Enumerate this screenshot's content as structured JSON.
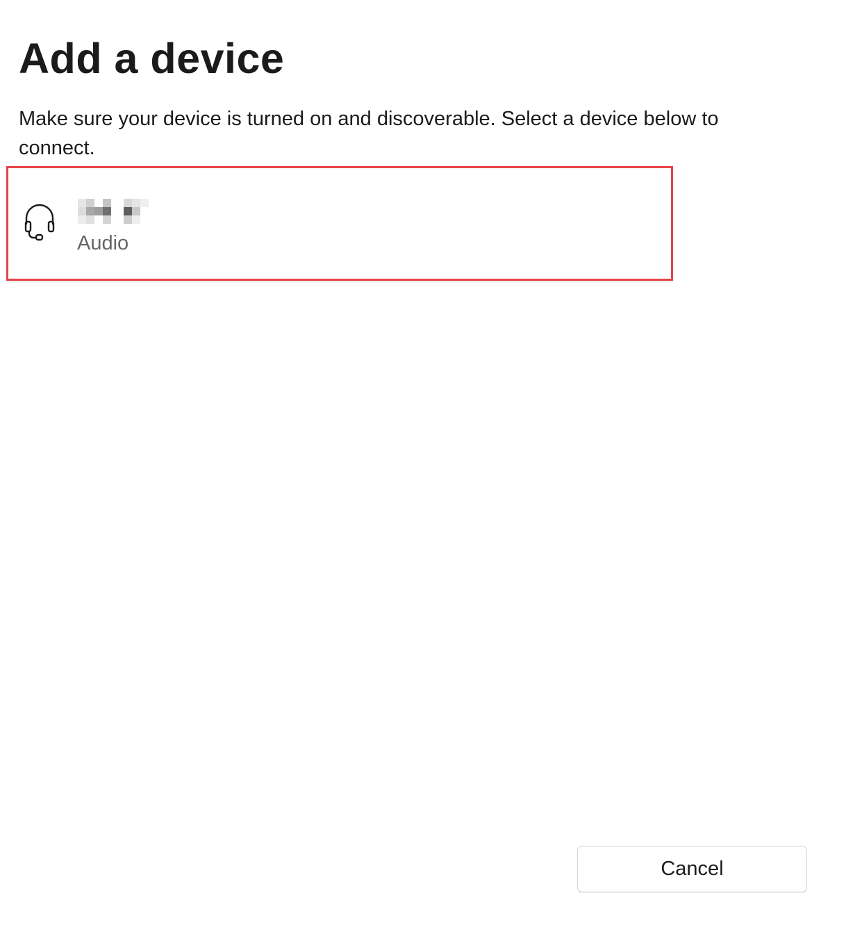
{
  "dialog": {
    "title": "Add a device",
    "instructions": "Make sure your device is turned on and discoverable. Select a device below to connect."
  },
  "devices": [
    {
      "name": "",
      "name_redacted": true,
      "type": "Audio",
      "icon": "headset-icon"
    }
  ],
  "footer": {
    "cancel_label": "Cancel"
  },
  "colors": {
    "highlight_border": "#e8424a",
    "title_text": "#1b1b1b",
    "secondary_text": "#666666"
  }
}
